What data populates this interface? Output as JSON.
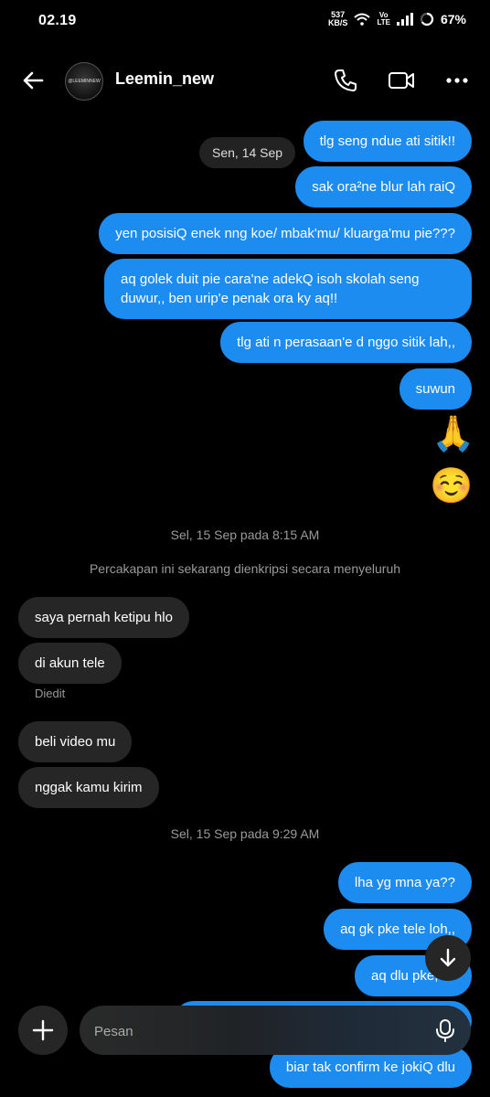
{
  "status_bar": {
    "time": "02.19",
    "net_speed_value": "537",
    "net_speed_unit": "KB/S",
    "volte_top": "Vo",
    "volte_bottom": "LTE",
    "battery": "67%"
  },
  "header": {
    "name": "Leemin_new",
    "avatar_text": "@LEEMINNEW"
  },
  "conversation": {
    "date_pill": "Sen, 14 Sep",
    "outgoing_1": [
      "tlg seng ndue ati sitik!!",
      "sak ora²ne blur lah raiQ",
      "yen posisiQ enek nng koe/ mbak'mu/ kluarga'mu pie???",
      "aq golek duit pie cara'ne adekQ isoh skolah seng duwur,, ben urip'e penak ora ky aq!!",
      "tlg ati n perasaan'e d nggo sitik lah,,",
      "suwun"
    ],
    "emojis": [
      "🙏",
      "☺️"
    ],
    "timestamp_1": "Sel, 15 Sep pada 8:15 AM",
    "encryption_notice": "Percakapan ini sekarang dienkripsi secara menyeluruh",
    "incoming": [
      "saya pernah ketipu hlo",
      "di akun tele",
      "beli video mu",
      "nggak kamu kirim"
    ],
    "edited_label": "Diedit",
    "timestamp_2": "Sel, 15 Sep pada 9:29 AM",
    "outgoing_2": [
      "lha yg mna ya??",
      "aq gk pke tele loh,,",
      "aq dlu pke,",
      "",
      "biar tak confirm ke jokiQ dlu"
    ]
  },
  "composer": {
    "placeholder": "Pesan"
  },
  "icons": {
    "back": "arrow-left-icon",
    "call": "phone-icon",
    "video": "video-camera-icon",
    "more": "more-horizontal-icon",
    "scroll_down": "arrow-down-icon",
    "add": "plus-icon",
    "mic": "microphone-icon"
  },
  "colors": {
    "outgoing_bubble": "#1d8cf0",
    "incoming_bubble": "#262626",
    "background": "#000000"
  }
}
